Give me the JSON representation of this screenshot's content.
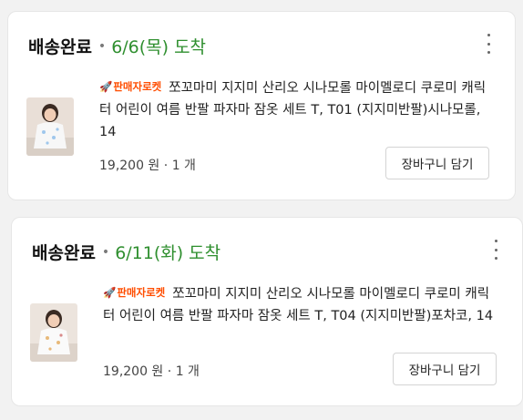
{
  "orders": [
    {
      "status": "배송완료",
      "separator": "•",
      "date": "6/6(목)",
      "arrive": "도착",
      "badge": "판매자로켓",
      "product_title": "쪼꼬마미 지지미 산리오 시나모롤 마이멜로디 쿠로미 캐릭터 어린이 여름 반팔 파자마 잠옷 세트 T, T01 (지지미반팔)시나모롤, 14",
      "price": "19,200 원",
      "qty_separator": "·",
      "quantity": "1 개",
      "cart_button": "장바구니 담기"
    },
    {
      "status": "배송완료",
      "separator": "•",
      "date": "6/11(화)",
      "arrive": "도착",
      "badge": "판매자로켓",
      "product_title": "쪼꼬마미 지지미 산리오 시나모롤 마이멜로디 쿠로미 캐릭터 어린이 여름 반팔 파자마 잠옷 세트 T, T04 (지지미반팔)포차코, 14",
      "price": "19,200 원",
      "qty_separator": "·",
      "quantity": "1 개",
      "cart_button": "장바구니 담기"
    }
  ],
  "colors": {
    "delivered_green": "#2f8f2f",
    "rocket_orange": "#ff4d00"
  },
  "icons": {
    "menu": "more-vertical-icon",
    "badge": "rocket-icon"
  }
}
